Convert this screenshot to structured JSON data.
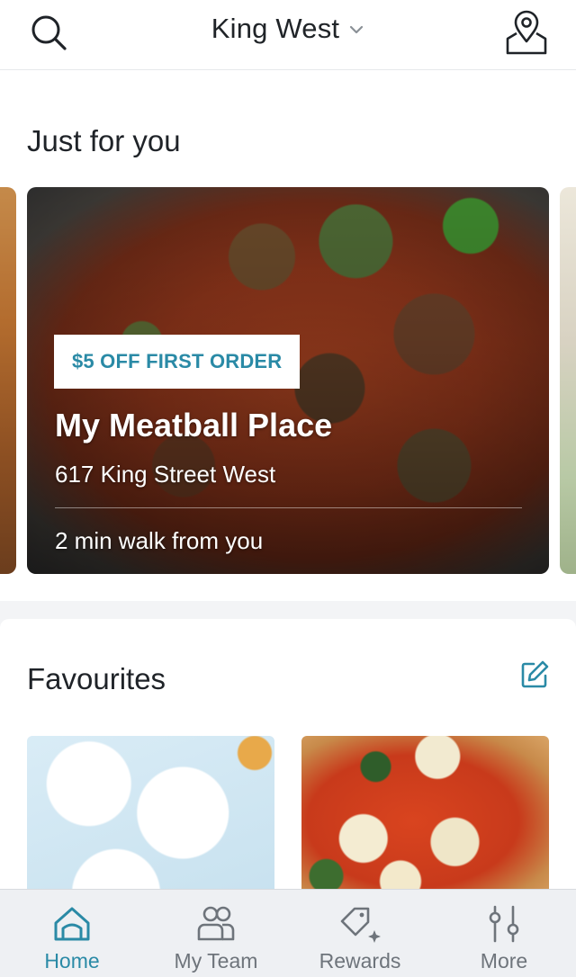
{
  "header": {
    "location": "King West",
    "search_icon": "search-icon",
    "map_icon": "map-pin-icon"
  },
  "just_for_you": {
    "title": "Just for you",
    "card": {
      "badge": "$5 OFF FIRST ORDER",
      "name": "My Meatball Place",
      "address": "617 King Street West",
      "distance": "2 min walk from you"
    }
  },
  "favourites": {
    "title": "Favourites",
    "edit_icon": "edit-icon"
  },
  "nav": {
    "items": [
      {
        "label": "Home",
        "icon": "home-icon",
        "active": true
      },
      {
        "label": "My Team",
        "icon": "team-icon",
        "active": false
      },
      {
        "label": "Rewards",
        "icon": "rewards-icon",
        "active": false
      },
      {
        "label": "More",
        "icon": "sliders-icon",
        "active": false
      }
    ]
  },
  "colors": {
    "accent": "#2a8aa6",
    "text": "#1f2328",
    "muted": "#6e747b"
  }
}
